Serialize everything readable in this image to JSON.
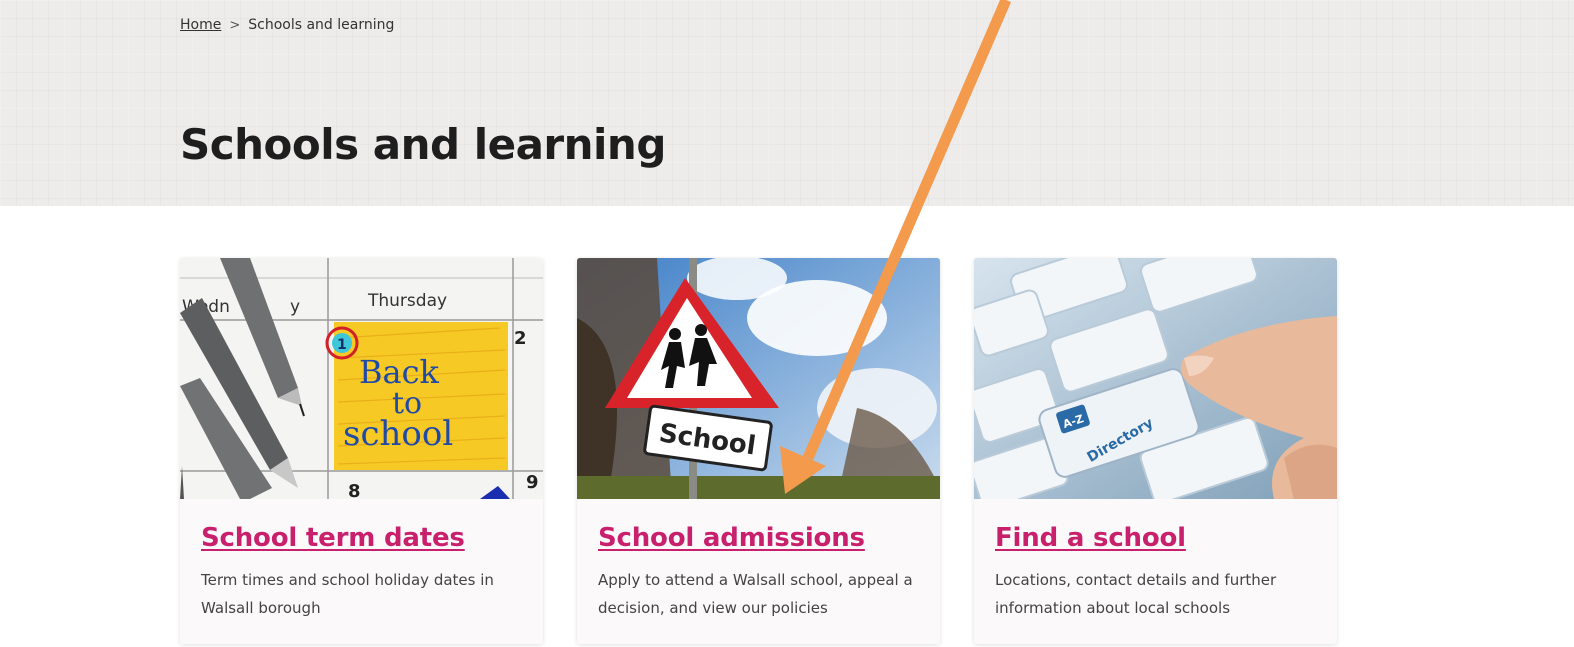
{
  "breadcrumb": {
    "home": "Home",
    "separator": ">",
    "current": "Schools and learning"
  },
  "page": {
    "title": "Schools and learning"
  },
  "cards": [
    {
      "title": "School term dates",
      "description": "Term times and school holiday dates in Walsall borough",
      "image_text": {
        "day1": "Wedn",
        "day1_end": "y",
        "day2": "Thursday",
        "circled_date": "1",
        "date_2": "2",
        "date_8": "8",
        "date_9": "9",
        "note_line1": "Back",
        "note_line2": "to",
        "note_line3": "school"
      }
    },
    {
      "title": "School admissions",
      "description": "Apply to attend a Walsall school, appeal a decision, and view our policies",
      "image_text": {
        "sign_plate": "School"
      }
    },
    {
      "title": "Find a school",
      "description": "Locations, contact details and further information about local schools",
      "image_text": {
        "key_label": "A-Z",
        "key_word": "Directory"
      }
    }
  ],
  "colors": {
    "link": "#c8206d",
    "arrow": "#f39a4d",
    "hero_bg": "#eeeceb"
  }
}
